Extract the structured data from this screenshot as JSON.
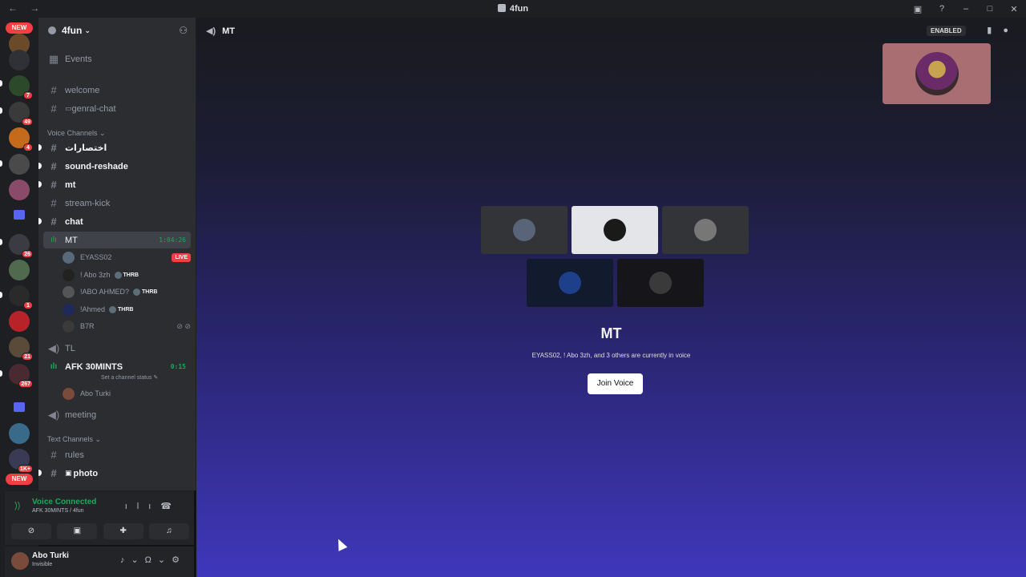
{
  "titlebar": {
    "nav": "← →",
    "title": "4fun"
  },
  "servers": {
    "new_top": "NEW",
    "new_bottom": "NEW",
    "badges": [
      "7",
      "49",
      "4",
      "26",
      "1",
      "21",
      "267",
      "1K+"
    ]
  },
  "guild": {
    "name": "4fun"
  },
  "channels": {
    "events": "Events",
    "welcome": "welcome",
    "genral_chat": "genral-chat",
    "voice_category": "Voice Channels",
    "ch_arabic": "اختصارات",
    "sound_reshade": "sound-reshade",
    "mt_text": "mt",
    "stream_kick": "stream-kick",
    "chat": "chat",
    "mt_voice": "MT",
    "mt_timer": "1:04:26",
    "mt_users": [
      {
        "name": "EYASS02",
        "live": "LIVE"
      },
      {
        "name": "! Abo 3zh",
        "tag": "THRB"
      },
      {
        "name": "!ABO AHMED?",
        "tag": "THRB"
      },
      {
        "name": "!Ahmed",
        "tag": "THRB"
      },
      {
        "name": "B7R"
      }
    ],
    "tl": "TL",
    "afk": "AFK 30MINTS",
    "afk_timer": "0:15",
    "afk_status": "Set a channel status",
    "afk_user": "Abo Turki",
    "meeting": "meeting",
    "text_category": "Text Channels",
    "rules": "rules",
    "photo": "photo"
  },
  "voice_panel": {
    "status": "Voice Connected",
    "location": "AFK 30MINTS / 4fun"
  },
  "user_panel": {
    "name": "Abo Turki",
    "status": "Invisible"
  },
  "stage": {
    "channel": "MT",
    "enabled_badge": "ENABLED",
    "title": "MT",
    "subtitle": "EYASS02, ! Abo 3zh, and 3 others are currently in voice",
    "join_button": "Join Voice"
  }
}
